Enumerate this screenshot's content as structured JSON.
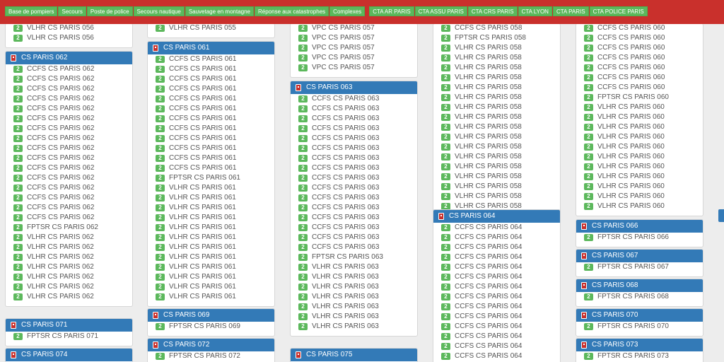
{
  "topbar": {
    "buttons": [
      "Base de pompiers",
      "Secours",
      "Poste de police",
      "Secours nautique",
      "Sauvetage en montagne",
      "Réponse aux catastrophes",
      "Complexes",
      "CTA AR PARIS",
      "CTA ASSU PARIS",
      "CTA CRS PARIS",
      "CTA LYON",
      "CTA PARIS",
      "CTA POLICE PARIS"
    ]
  },
  "columns": [
    {
      "panels": [
        {
          "title": "",
          "vehicles": [
            {
              "status": "2",
              "name": "VLHR CS PARIS 056"
            },
            {
              "status": "2",
              "name": "VLHR CS PARIS 056"
            }
          ]
        },
        {
          "title": "CS PARIS 062",
          "vehicles": [
            {
              "status": "2",
              "name": "CCFS CS PARIS 062"
            },
            {
              "status": "2",
              "name": "CCFS CS PARIS 062"
            },
            {
              "status": "2",
              "name": "CCFS CS PARIS 062"
            },
            {
              "status": "2",
              "name": "CCFS CS PARIS 062"
            },
            {
              "status": "2",
              "name": "CCFS CS PARIS 062"
            },
            {
              "status": "2",
              "name": "CCFS CS PARIS 062"
            },
            {
              "status": "2",
              "name": "CCFS CS PARIS 062"
            },
            {
              "status": "2",
              "name": "CCFS CS PARIS 062"
            },
            {
              "status": "2",
              "name": "CCFS CS PARIS 062"
            },
            {
              "status": "2",
              "name": "CCFS CS PARIS 062"
            },
            {
              "status": "2",
              "name": "CCFS CS PARIS 062"
            },
            {
              "status": "2",
              "name": "CCFS CS PARIS 062"
            },
            {
              "status": "2",
              "name": "CCFS CS PARIS 062"
            },
            {
              "status": "2",
              "name": "CCFS CS PARIS 062"
            },
            {
              "status": "2",
              "name": "CCFS CS PARIS 062"
            },
            {
              "status": "2",
              "name": "CCFS CS PARIS 062"
            },
            {
              "status": "2",
              "name": "FPTSR CS PARIS 062"
            },
            {
              "status": "2",
              "name": "VLHR CS PARIS 062"
            },
            {
              "status": "2",
              "name": "VLHR CS PARIS 062"
            },
            {
              "status": "2",
              "name": "VLHR CS PARIS 062"
            },
            {
              "status": "2",
              "name": "VLHR CS PARIS 062"
            },
            {
              "status": "2",
              "name": "VLHR CS PARIS 062"
            },
            {
              "status": "2",
              "name": "VLHR CS PARIS 062"
            },
            {
              "status": "2",
              "name": "VLHR CS PARIS 062"
            }
          ]
        },
        {
          "title": "CS PARIS 071",
          "vehicles": [
            {
              "status": "2",
              "name": "FPTSR CS PARIS 071"
            }
          ]
        },
        {
          "title": "CS PARIS 074",
          "vehicles": []
        }
      ]
    },
    {
      "panels": [
        {
          "title": "",
          "vehicles": [
            {
              "status": "2",
              "name": "VLHR CS PARIS 055"
            }
          ]
        },
        {
          "title": "CS PARIS 061",
          "vehicles": [
            {
              "status": "2",
              "name": "CCFS CS PARIS 061"
            },
            {
              "status": "2",
              "name": "CCFS CS PARIS 061"
            },
            {
              "status": "2",
              "name": "CCFS CS PARIS 061"
            },
            {
              "status": "2",
              "name": "CCFS CS PARIS 061"
            },
            {
              "status": "2",
              "name": "CCFS CS PARIS 061"
            },
            {
              "status": "2",
              "name": "CCFS CS PARIS 061"
            },
            {
              "status": "2",
              "name": "CCFS CS PARIS 061"
            },
            {
              "status": "2",
              "name": "CCFS CS PARIS 061"
            },
            {
              "status": "2",
              "name": "CCFS CS PARIS 061"
            },
            {
              "status": "2",
              "name": "CCFS CS PARIS 061"
            },
            {
              "status": "2",
              "name": "CCFS CS PARIS 061"
            },
            {
              "status": "2",
              "name": "CCFS CS PARIS 061"
            },
            {
              "status": "2",
              "name": "FPTSR CS PARIS 061"
            },
            {
              "status": "2",
              "name": "VLHR CS PARIS 061"
            },
            {
              "status": "2",
              "name": "VLHR CS PARIS 061"
            },
            {
              "status": "2",
              "name": "VLHR CS PARIS 061"
            },
            {
              "status": "2",
              "name": "VLHR CS PARIS 061"
            },
            {
              "status": "2",
              "name": "VLHR CS PARIS 061"
            },
            {
              "status": "2",
              "name": "VLHR CS PARIS 061"
            },
            {
              "status": "2",
              "name": "VLHR CS PARIS 061"
            },
            {
              "status": "2",
              "name": "VLHR CS PARIS 061"
            },
            {
              "status": "2",
              "name": "VLHR CS PARIS 061"
            },
            {
              "status": "2",
              "name": "VLHR CS PARIS 061"
            },
            {
              "status": "2",
              "name": "VLHR CS PARIS 061"
            },
            {
              "status": "2",
              "name": "VLHR CS PARIS 061"
            }
          ]
        },
        {
          "title": "CS PARIS 069",
          "vehicles": [
            {
              "status": "2",
              "name": "FPTSR CS PARIS 069"
            }
          ]
        },
        {
          "title": "CS PARIS 072",
          "vehicles": [
            {
              "status": "2",
              "name": "FPTSR CS PARIS 072"
            }
          ]
        }
      ]
    },
    {
      "panels": [
        {
          "title": "",
          "vehicles": [
            {
              "status": "2",
              "name": "VPC CS PARIS 057"
            },
            {
              "status": "2",
              "name": "VPC CS PARIS 057"
            },
            {
              "status": "2",
              "name": "VPC CS PARIS 057"
            },
            {
              "status": "2",
              "name": "VPC CS PARIS 057"
            },
            {
              "status": "2",
              "name": "VPC CS PARIS 057"
            }
          ]
        },
        {
          "title": "CS PARIS 063",
          "vehicles": [
            {
              "status": "2",
              "name": "CCFS CS PARIS 063"
            },
            {
              "status": "2",
              "name": "CCFS CS PARIS 063"
            },
            {
              "status": "2",
              "name": "CCFS CS PARIS 063"
            },
            {
              "status": "2",
              "name": "CCFS CS PARIS 063"
            },
            {
              "status": "2",
              "name": "CCFS CS PARIS 063"
            },
            {
              "status": "2",
              "name": "CCFS CS PARIS 063"
            },
            {
              "status": "2",
              "name": "CCFS CS PARIS 063"
            },
            {
              "status": "2",
              "name": "CCFS CS PARIS 063"
            },
            {
              "status": "2",
              "name": "CCFS CS PARIS 063"
            },
            {
              "status": "2",
              "name": "CCFS CS PARIS 063"
            },
            {
              "status": "2",
              "name": "CCFS CS PARIS 063"
            },
            {
              "status": "2",
              "name": "CCFS CS PARIS 063"
            },
            {
              "status": "2",
              "name": "CCFS CS PARIS 063"
            },
            {
              "status": "2",
              "name": "CCFS CS PARIS 063"
            },
            {
              "status": "2",
              "name": "CCFS CS PARIS 063"
            },
            {
              "status": "2",
              "name": "CCFS CS PARIS 063"
            },
            {
              "status": "2",
              "name": "FPTSR CS PARIS 063"
            },
            {
              "status": "2",
              "name": "VLHR CS PARIS 063"
            },
            {
              "status": "2",
              "name": "VLHR CS PARIS 063"
            },
            {
              "status": "2",
              "name": "VLHR CS PARIS 063"
            },
            {
              "status": "2",
              "name": "VLHR CS PARIS 063"
            },
            {
              "status": "2",
              "name": "VLHR CS PARIS 063"
            },
            {
              "status": "2",
              "name": "VLHR CS PARIS 063"
            },
            {
              "status": "2",
              "name": "VLHR CS PARIS 063"
            }
          ]
        },
        {
          "title": "CS PARIS 075",
          "vehicles": []
        }
      ]
    },
    {
      "panels": [
        {
          "title": "",
          "vehicles": [
            {
              "status": "2",
              "name": "CCFS CS PARIS 058"
            },
            {
              "status": "2",
              "name": "FPTSR CS PARIS 058"
            },
            {
              "status": "2",
              "name": "VLHR CS PARIS 058"
            },
            {
              "status": "2",
              "name": "VLHR CS PARIS 058"
            },
            {
              "status": "2",
              "name": "VLHR CS PARIS 058"
            },
            {
              "status": "2",
              "name": "VLHR CS PARIS 058"
            },
            {
              "status": "2",
              "name": "VLHR CS PARIS 058"
            },
            {
              "status": "2",
              "name": "VLHR CS PARIS 058"
            },
            {
              "status": "2",
              "name": "VLHR CS PARIS 058"
            },
            {
              "status": "2",
              "name": "VLHR CS PARIS 058"
            },
            {
              "status": "2",
              "name": "VLHR CS PARIS 058"
            },
            {
              "status": "2",
              "name": "VLHR CS PARIS 058"
            },
            {
              "status": "2",
              "name": "VLHR CS PARIS 058"
            },
            {
              "status": "2",
              "name": "VLHR CS PARIS 058"
            },
            {
              "status": "2",
              "name": "VLHR CS PARIS 058"
            },
            {
              "status": "2",
              "name": "VLHR CS PARIS 058"
            },
            {
              "status": "2",
              "name": "VLHR CS PARIS 058"
            },
            {
              "status": "2",
              "name": "VLHR CS PARIS 058"
            },
            {
              "status": "2",
              "name": "VLHR CS PARIS 058"
            }
          ]
        },
        {
          "title": "CS PARIS 064",
          "vehicles": [
            {
              "status": "2",
              "name": "CCFS CS PARIS 064"
            },
            {
              "status": "2",
              "name": "CCFS CS PARIS 064"
            },
            {
              "status": "2",
              "name": "CCFS CS PARIS 064"
            },
            {
              "status": "2",
              "name": "CCFS CS PARIS 064"
            },
            {
              "status": "2",
              "name": "CCFS CS PARIS 064"
            },
            {
              "status": "2",
              "name": "CCFS CS PARIS 064"
            },
            {
              "status": "2",
              "name": "CCFS CS PARIS 064"
            },
            {
              "status": "2",
              "name": "CCFS CS PARIS 064"
            },
            {
              "status": "2",
              "name": "CCFS CS PARIS 064"
            },
            {
              "status": "2",
              "name": "CCFS CS PARIS 064"
            },
            {
              "status": "2",
              "name": "CCFS CS PARIS 064"
            },
            {
              "status": "2",
              "name": "CCFS CS PARIS 064"
            },
            {
              "status": "2",
              "name": "CCFS CS PARIS 064"
            },
            {
              "status": "2",
              "name": "CCFS CS PARIS 064"
            }
          ]
        }
      ]
    },
    {
      "panels": [
        {
          "title": "",
          "vehicles": [
            {
              "status": "2",
              "name": "CCFS CS PARIS 060"
            },
            {
              "status": "2",
              "name": "CCFS CS PARIS 060"
            },
            {
              "status": "2",
              "name": "CCFS CS PARIS 060"
            },
            {
              "status": "2",
              "name": "CCFS CS PARIS 060"
            },
            {
              "status": "2",
              "name": "CCFS CS PARIS 060"
            },
            {
              "status": "2",
              "name": "CCFS CS PARIS 060"
            },
            {
              "status": "2",
              "name": "CCFS CS PARIS 060"
            },
            {
              "status": "2",
              "name": "FPTSR CS PARIS 060"
            },
            {
              "status": "2",
              "name": "VLHR CS PARIS 060"
            },
            {
              "status": "2",
              "name": "VLHR CS PARIS 060"
            },
            {
              "status": "2",
              "name": "VLHR CS PARIS 060"
            },
            {
              "status": "2",
              "name": "VLHR CS PARIS 060"
            },
            {
              "status": "2",
              "name": "VLHR CS PARIS 060"
            },
            {
              "status": "2",
              "name": "VLHR CS PARIS 060"
            },
            {
              "status": "2",
              "name": "VLHR CS PARIS 060"
            },
            {
              "status": "2",
              "name": "VLHR CS PARIS 060"
            },
            {
              "status": "2",
              "name": "VLHR CS PARIS 060"
            },
            {
              "status": "2",
              "name": "VLHR CS PARIS 060"
            },
            {
              "status": "2",
              "name": "VLHR CS PARIS 060"
            }
          ]
        },
        {
          "title": "CS PARIS 066",
          "vehicles": [
            {
              "status": "2",
              "name": "FPTSR CS PARIS 066"
            }
          ]
        },
        {
          "title": "CS PARIS 067",
          "vehicles": [
            {
              "status": "2",
              "name": "FPTSR CS PARIS 067"
            }
          ]
        },
        {
          "title": "CS PARIS 068",
          "vehicles": [
            {
              "status": "2",
              "name": "FPTSR CS PARIS 068"
            }
          ]
        },
        {
          "title": "CS PARIS 070",
          "vehicles": [
            {
              "status": "2",
              "name": "FPTSR CS PARIS 070"
            }
          ]
        },
        {
          "title": "CS PARIS 073",
          "vehicles": [
            {
              "status": "2",
              "name": "FPTSR CS PARIS 073"
            }
          ]
        }
      ]
    }
  ]
}
